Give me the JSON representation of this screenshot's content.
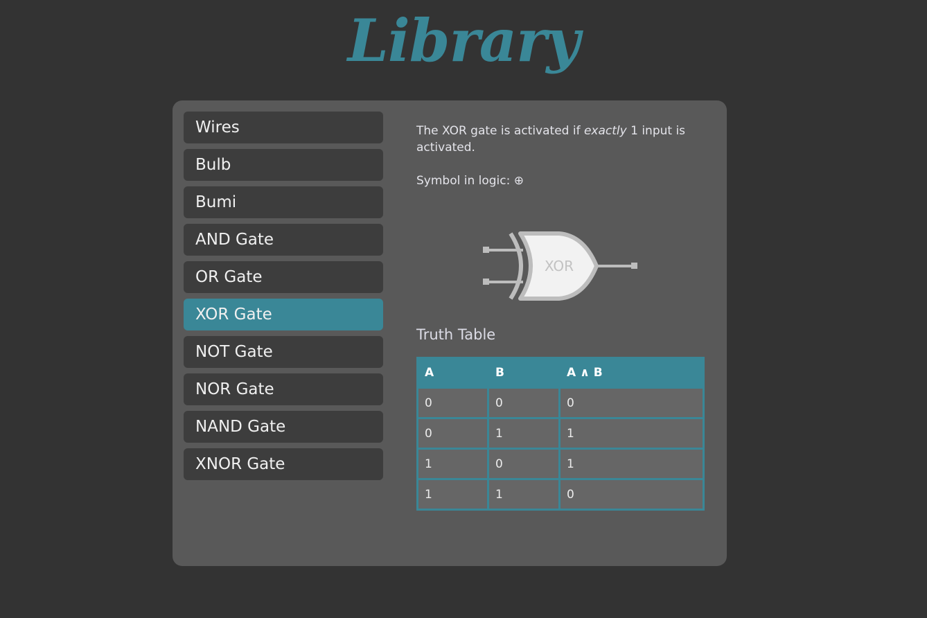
{
  "header": {
    "title": "Library"
  },
  "nav": {
    "items": [
      {
        "label": "Wires",
        "name": "nav-item-wires"
      },
      {
        "label": "Bulb",
        "name": "nav-item-bulb"
      },
      {
        "label": "Bumi",
        "name": "nav-item-bumi"
      },
      {
        "label": "AND Gate",
        "name": "nav-item-and-gate"
      },
      {
        "label": "OR Gate",
        "name": "nav-item-or-gate"
      },
      {
        "label": "XOR Gate",
        "name": "nav-item-xor-gate",
        "active": true
      },
      {
        "label": "NOT Gate",
        "name": "nav-item-not-gate"
      },
      {
        "label": "NOR Gate",
        "name": "nav-item-nor-gate"
      },
      {
        "label": "NAND Gate",
        "name": "nav-item-nand-gate"
      },
      {
        "label": "XNOR Gate",
        "name": "nav-item-xnor-gate"
      }
    ]
  },
  "detail": {
    "desc_before": "The XOR gate is activated if ",
    "desc_emphasis": "exactly",
    "desc_after": " 1 input is activated.",
    "symbol_label": "Symbol in logic: ",
    "symbol": "⊕",
    "gate_label": "XOR",
    "truth_table_title": "Truth Table",
    "truth_table": {
      "headers": [
        "A",
        "B",
        "A ∧ B"
      ],
      "rows": [
        [
          "0",
          "0",
          "0"
        ],
        [
          "0",
          "1",
          "1"
        ],
        [
          "1",
          "0",
          "1"
        ],
        [
          "1",
          "1",
          "0"
        ]
      ]
    }
  },
  "colors": {
    "background": "#333333",
    "panel": "#595959",
    "accent": "#3a8797",
    "nav_item": "#3d3d3d",
    "table_cell": "#666666"
  }
}
